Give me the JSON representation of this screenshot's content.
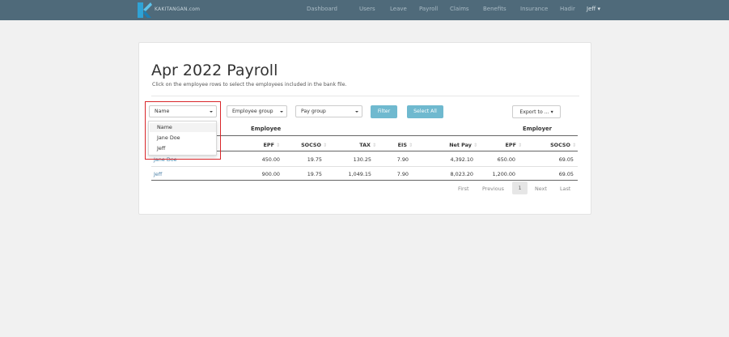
{
  "navbar": {
    "brand": "KAKITANGAN.com",
    "items": [
      "Dashboard",
      "Users",
      "Leave",
      "Payroll",
      "Claims",
      "Benefits",
      "Insurance",
      "Hadir"
    ],
    "user": "Jeff",
    "user_caret": "▾"
  },
  "page": {
    "title": "Apr 2022 Payroll",
    "subtitle": "Click on the employee rows to select the employees included in the bank file."
  },
  "filters": {
    "name": "Name",
    "employee_group": "Employee group",
    "pay_group": "Pay group",
    "filter_button": "Filter",
    "select_all_button": "Select All",
    "export_button": "Export to ... ▾"
  },
  "name_dropdown": {
    "options": [
      "Name",
      "Jane Doe",
      "Jeff"
    ]
  },
  "table": {
    "groups": {
      "employee": "Employee",
      "employer": "Employer"
    },
    "columns": [
      "EPF",
      "SOCSO",
      "TAX",
      "EIS",
      "Net Pay",
      "EPF",
      "SOCSO"
    ],
    "sort_icon": "⇕",
    "rows": [
      {
        "name": "Jane Doe",
        "values": [
          "450.00",
          "19.75",
          "130.25",
          "7.90",
          "4,392.10",
          "650.00",
          "69.05"
        ]
      },
      {
        "name": "Jeff",
        "values": [
          "900.00",
          "19.75",
          "1,049.15",
          "7.90",
          "8,023.20",
          "1,200.00",
          "69.05"
        ]
      }
    ]
  },
  "pagination": {
    "first": "First",
    "previous": "Previous",
    "current": "1",
    "next": "Next",
    "last": "Last"
  },
  "colors": {
    "navbar": "#4f6a7a",
    "button_info": "#6fb9cf",
    "highlight_box": "#d9262a",
    "link": "#4a7fa6"
  }
}
